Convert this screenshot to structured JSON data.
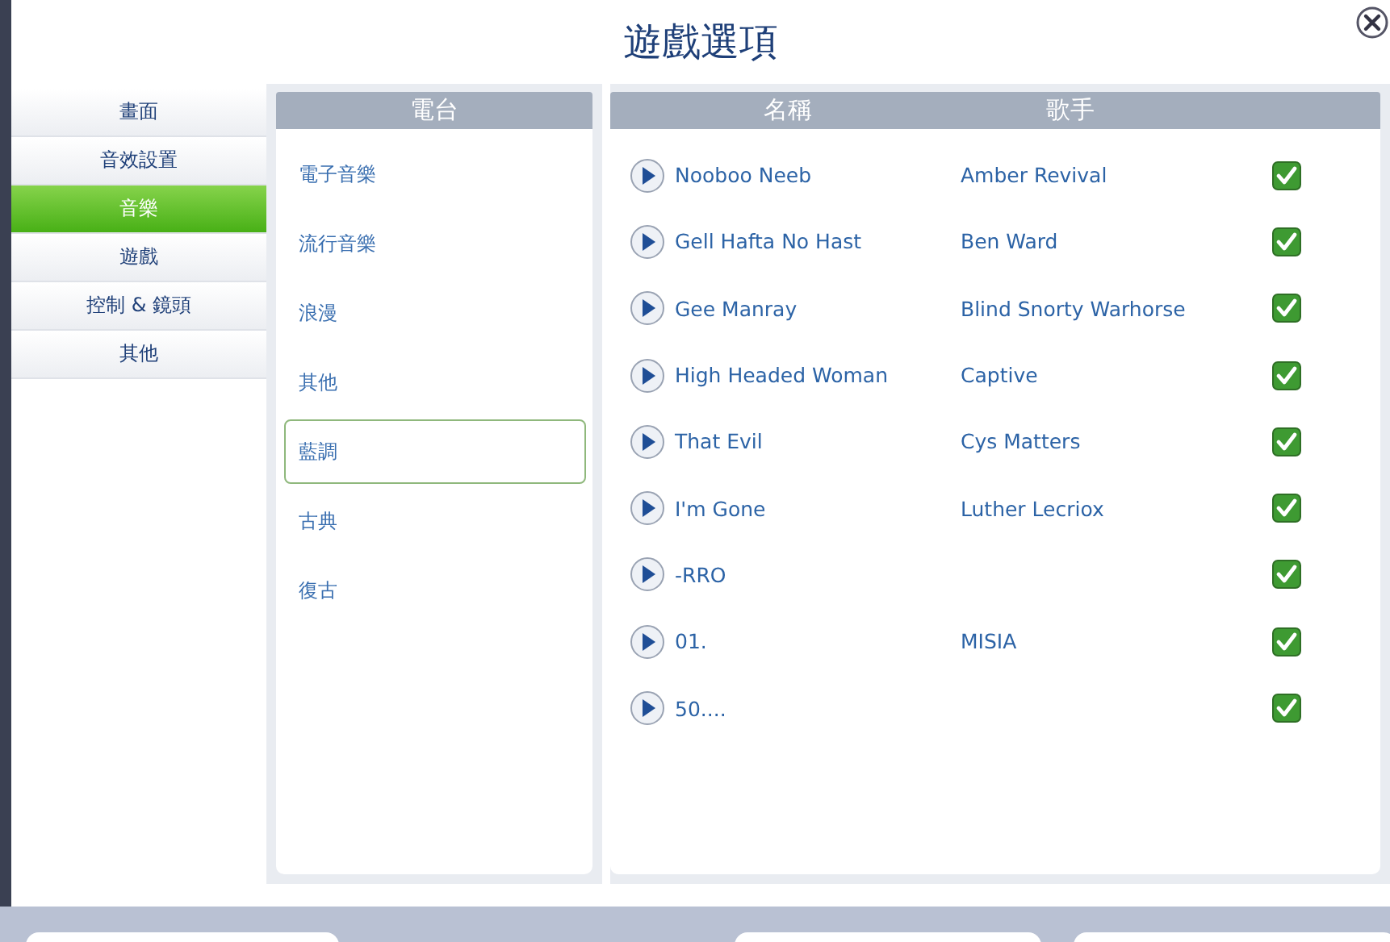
{
  "window": {
    "title": "遊戲選項"
  },
  "sidebar": {
    "items": [
      {
        "label": "畫面",
        "selected": false
      },
      {
        "label": "音效設置",
        "selected": false
      },
      {
        "label": "音樂",
        "selected": true
      },
      {
        "label": "遊戲",
        "selected": false
      },
      {
        "label": "控制 & 鏡頭",
        "selected": false
      },
      {
        "label": "其他",
        "selected": false
      }
    ]
  },
  "stations": {
    "header": "電台",
    "items": [
      {
        "label": "電子音樂",
        "selected": false
      },
      {
        "label": "流行音樂",
        "selected": false
      },
      {
        "label": "浪漫",
        "selected": false
      },
      {
        "label": "其他",
        "selected": false
      },
      {
        "label": "藍調",
        "selected": true
      },
      {
        "label": "古典",
        "selected": false
      },
      {
        "label": "復古",
        "selected": false
      }
    ]
  },
  "songs": {
    "columns": [
      "名稱",
      "歌手"
    ],
    "rows": [
      {
        "name": "Nooboo Neeb",
        "artist": "Amber Revival",
        "checked": true
      },
      {
        "name": "Gell Hafta No Hast",
        "artist": "Ben Ward",
        "checked": true
      },
      {
        "name": "Gee Manray",
        "artist": "Blind Snorty Warhorse",
        "checked": true
      },
      {
        "name": "High Headed Woman",
        "artist": "Captive",
        "checked": true
      },
      {
        "name": "That Evil",
        "artist": "Cys Matters",
        "checked": true
      },
      {
        "name": "I'm Gone",
        "artist": "Luther Lecriox",
        "checked": true
      },
      {
        "name": "-RRO",
        "checked": true
      },
      {
        "name": "01.",
        "artist": "MISIA",
        "checked": true
      },
      {
        "name": "50....",
        "checked": true
      }
    ]
  }
}
